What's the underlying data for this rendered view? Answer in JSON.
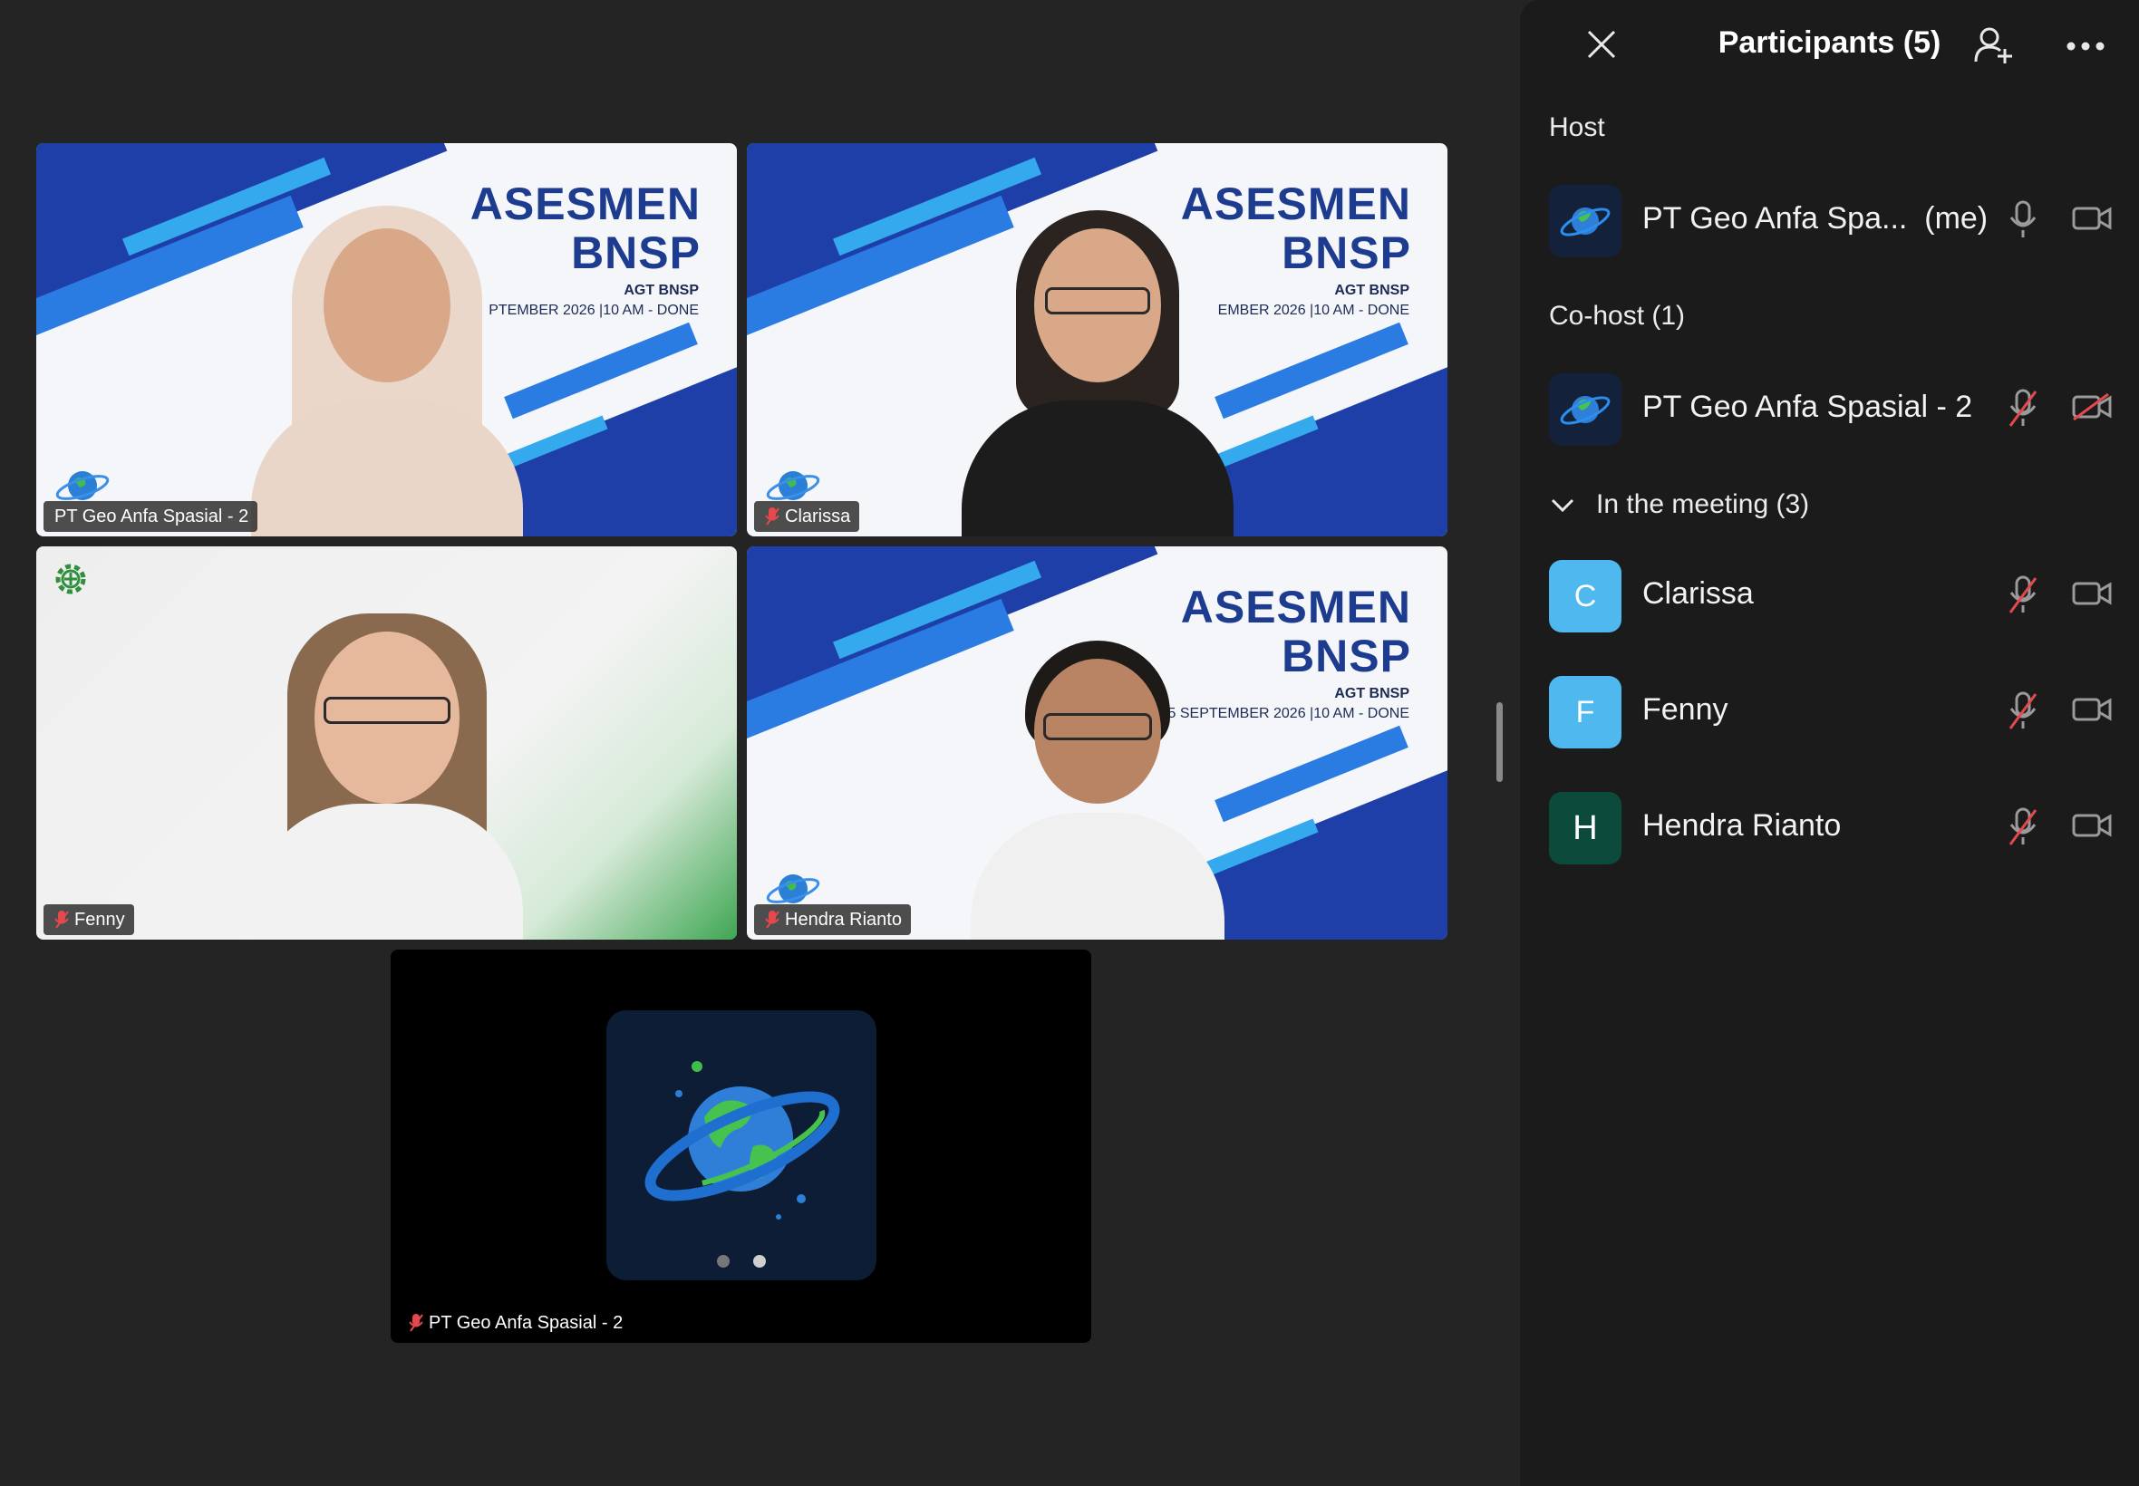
{
  "banner": {
    "title_line1": "ASESMEN",
    "title_line2": "BNSP",
    "subtitle": "AGT BNSP",
    "date_t1": "PTEMBER 2026 |10 AM - DONE",
    "date_t2": "EMBER 2026 |10 AM - DONE",
    "date_t4": "5 SEPTEMBER 2026 |10 AM - DONE"
  },
  "tiles": [
    {
      "name": "PT Geo Anfa Spasial - 2",
      "muted": false
    },
    {
      "name": "Clarissa",
      "muted": true
    },
    {
      "name": "Fenny",
      "muted": true,
      "active_speaker": true
    },
    {
      "name": "Hendra Rianto",
      "muted": true
    },
    {
      "name": "PT Geo Anfa Spasial - 2",
      "muted": true,
      "camera_off": true
    }
  ],
  "panel": {
    "title": "Participants (5)",
    "host_label": "Host",
    "cohost_label": "Co-host (1)",
    "meeting_label": "In the meeting (3)",
    "host": {
      "name": "PT Geo Anfa Spa...",
      "suffix": "(me)"
    },
    "cohost": {
      "name": "PT Geo Anfa Spasial - 2"
    },
    "members": [
      {
        "initial": "C",
        "name": "Clarissa",
        "color": "#4fb9ef"
      },
      {
        "initial": "F",
        "name": "Fenny",
        "color": "#4fb9ef"
      },
      {
        "initial": "H",
        "name": "Hendra Rianto",
        "color": "#0c4a3c"
      }
    ]
  },
  "colors": {
    "accent_green": "#3ac14f",
    "muted_red": "#e5484d",
    "panel_bg": "#1b1b1b"
  },
  "icons": [
    "close-icon",
    "add-participant-icon",
    "more-icon",
    "microphone-icon",
    "microphone-muted-icon",
    "video-camera-icon",
    "video-camera-off-icon",
    "chevron-down-icon",
    "gear-icon",
    "globe-logo-icon"
  ]
}
